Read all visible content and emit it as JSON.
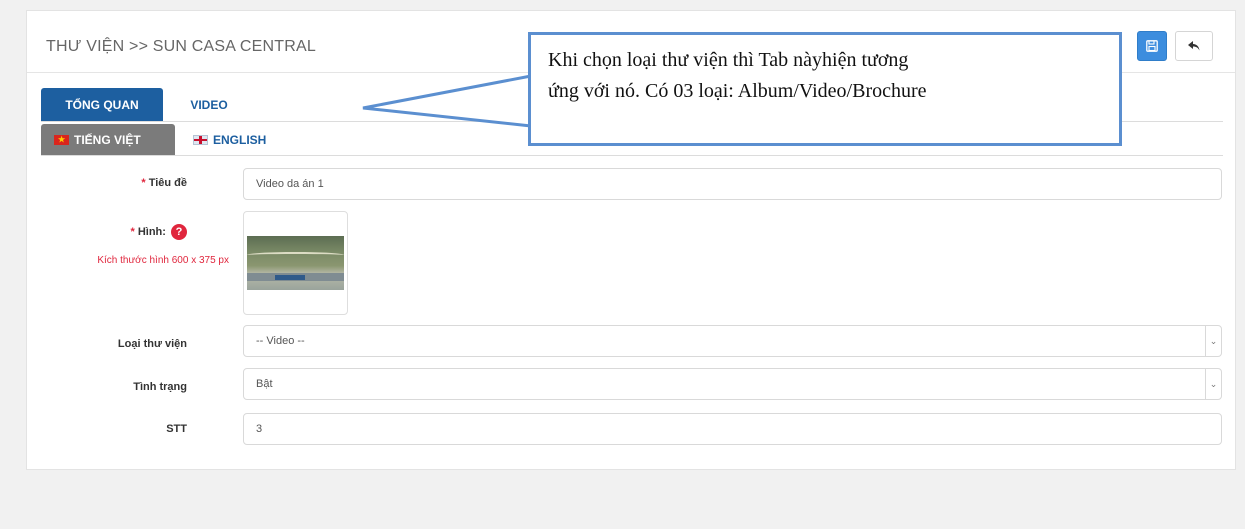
{
  "header": {
    "title": "THƯ VIỆN >> SUN CASA CENTRAL",
    "save_icon": "floppy-disk-icon",
    "back_icon": "reply-arrow-icon"
  },
  "tabs": [
    {
      "label": "TỔNG QUAN",
      "active": true
    },
    {
      "label": "VIDEO",
      "active": false
    }
  ],
  "lang_tabs": [
    {
      "label": "TIẾNG VIỆT",
      "flag": "vn-flag-icon",
      "active": true
    },
    {
      "label": "ENGLISH",
      "flag": "uk-flag-icon",
      "active": false
    }
  ],
  "form": {
    "title": {
      "label": "Tiêu đề",
      "required": "*",
      "value": "Video da án 1"
    },
    "image": {
      "label": "Hình:",
      "required": "*",
      "hint": "Kích thước hình 600 x 375 px",
      "help_icon": "?"
    },
    "library_type": {
      "label": "Loại thư viện",
      "value": "-- Video --"
    },
    "status": {
      "label": "Tình trạng",
      "value": "Bật"
    },
    "order": {
      "label": "STT",
      "value": "3"
    }
  },
  "callout": {
    "line1": "Khi chọn loại thư viện thì Tab nàyhiện tương",
    "line2": "ứng với nó. Có 03 loại: Album/Video/Brochure"
  },
  "colors": {
    "primary": "#1d5fa0",
    "save": "#3c8dde",
    "required": "#e0263d",
    "callout_border": "#5b8fd0"
  }
}
